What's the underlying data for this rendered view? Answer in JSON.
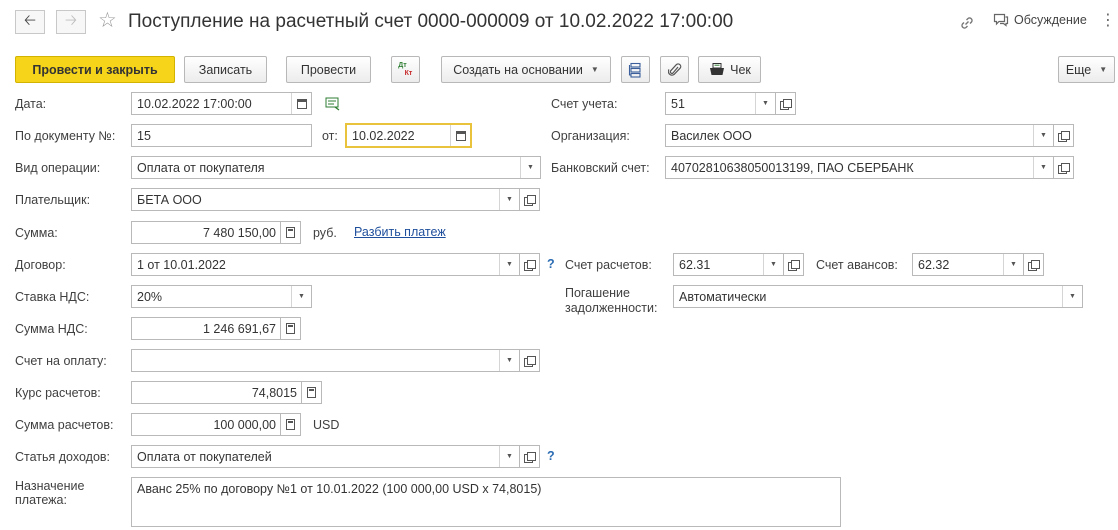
{
  "title": "Поступление на расчетный счет 0000-000009 от 10.02.2022 17:00:00",
  "header": {
    "discuss_label": "Обсуждение"
  },
  "toolbar": {
    "post_close": "Провести и закрыть",
    "save": "Записать",
    "post": "Провести",
    "dt_kt_top": "Дт",
    "dt_kt_bottom": "Кт",
    "create_based": "Создать на основании",
    "check": "Чек",
    "more": "Еще"
  },
  "form": {
    "date": {
      "label": "Дата:",
      "value": "10.02.2022 17:00:00"
    },
    "doc_number": {
      "label": "По документу №:",
      "value": "15"
    },
    "doc_date": {
      "label": "от:",
      "value": "10.02.2022"
    },
    "operation_type": {
      "label": "Вид операции:",
      "value": "Оплата от покупателя"
    },
    "payer": {
      "label": "Плательщик:",
      "value": "БЕТА ООО"
    },
    "amount": {
      "label": "Сумма:",
      "value": "7 480 150,00",
      "currency": "руб.",
      "split_link": "Разбить платеж"
    },
    "contract": {
      "label": "Договор:",
      "value": "1 от 10.01.2022",
      "help": "?"
    },
    "vat_rate": {
      "label": "Ставка НДС:",
      "value": "20%"
    },
    "vat_amount": {
      "label": "Сумма НДС:",
      "value": "1 246 691,67"
    },
    "invoice": {
      "label": "Счет на оплату:",
      "value": ""
    },
    "exchange_rate": {
      "label": "Курс расчетов:",
      "value": "74,8015"
    },
    "settlement_amount": {
      "label": "Сумма расчетов:",
      "value": "100 000,00",
      "currency": "USD"
    },
    "income_item": {
      "label": "Статья доходов:",
      "value": "Оплата от покупателей",
      "help": "?"
    },
    "purpose": {
      "label_line1": "Назначение",
      "label_line2": "платежа:",
      "value": "Аванс 25% по договору №1 от 10.01.2022 (100 000,00 USD x 74,8015)"
    },
    "account": {
      "label": "Счет учета:",
      "value": "51"
    },
    "organization": {
      "label": "Организация:",
      "value": "Василек ООО"
    },
    "bank_account": {
      "label": "Банковский счет:",
      "value": "40702810638050013199, ПАО СБЕРБАНК"
    },
    "settlement_account": {
      "label": "Счет расчетов:",
      "value": "62.31"
    },
    "advance_account": {
      "label": "Счет авансов:",
      "value": "62.32"
    },
    "debt_repayment": {
      "label_line1": "Погашение",
      "label_line2": "задолженности:",
      "value": "Автоматически"
    }
  }
}
